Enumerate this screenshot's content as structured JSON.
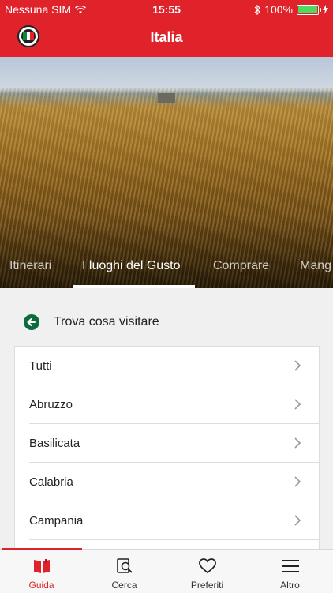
{
  "status_bar": {
    "carrier": "Nessuna SIM",
    "time": "15:55",
    "battery": "100%",
    "battery_level": 1.0
  },
  "header": {
    "title": "Italia",
    "logo": "italy-flag-logo"
  },
  "tabs": [
    {
      "label": "Itinerari",
      "active": false
    },
    {
      "label": "I luoghi del Gusto",
      "active": true
    },
    {
      "label": "Comprare",
      "active": false
    },
    {
      "label": "Mang",
      "active": false
    }
  ],
  "section": {
    "title": "Trova cosa visitare"
  },
  "list": [
    {
      "label": "Tutti"
    },
    {
      "label": "Abruzzo"
    },
    {
      "label": "Basilicata"
    },
    {
      "label": "Calabria"
    },
    {
      "label": "Campania"
    }
  ],
  "tab_bar": [
    {
      "label": "Guida",
      "icon": "book-icon",
      "active": true
    },
    {
      "label": "Cerca",
      "icon": "search-icon",
      "active": false
    },
    {
      "label": "Preferiti",
      "icon": "heart-icon",
      "active": false
    },
    {
      "label": "Altro",
      "icon": "menu-icon",
      "active": false
    }
  ],
  "colors": {
    "brand_red": "#e0232b",
    "accent_green": "#0b6b3a",
    "battery_green": "#4cd964"
  }
}
